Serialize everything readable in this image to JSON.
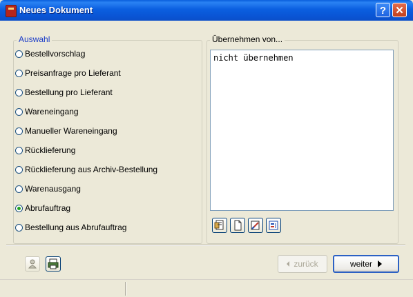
{
  "window": {
    "title": "Neues Dokument",
    "help_label": "?",
    "close_label": "✕"
  },
  "auswahl": {
    "legend": "Auswahl",
    "options": [
      {
        "label": "Bestellvorschlag",
        "checked": false
      },
      {
        "label": "Preisanfrage pro Lieferant",
        "checked": false
      },
      {
        "label": "Bestellung pro Lieferant",
        "checked": false
      },
      {
        "label": "Wareneingang",
        "checked": false
      },
      {
        "label": "Manueller Wareneingang",
        "checked": false
      },
      {
        "label": "Rücklieferung",
        "checked": false
      },
      {
        "label": "Rücklieferung aus Archiv-Bestellung",
        "checked": false
      },
      {
        "label": "Warenausgang",
        "checked": false
      },
      {
        "label": "Abrufauftrag",
        "checked": true
      },
      {
        "label": "Bestellung aus Abrufauftrag",
        "checked": false
      }
    ]
  },
  "uebernehmen": {
    "legend": "Übernehmen von...",
    "items": [
      "nicht übernehmen"
    ],
    "toolbar": [
      "document-search-icon",
      "blank-document-icon",
      "edit-document-icon",
      "list-properties-icon"
    ]
  },
  "bottom_icons": [
    "user-icon",
    "printer-icon"
  ],
  "navigation": {
    "back_label": "zurück",
    "next_label": "weiter"
  },
  "colors": {
    "titlebar": "#0a54d4",
    "face": "#ece9d8",
    "legend": "#1b3cc8",
    "radio_dot": "#21a121"
  }
}
